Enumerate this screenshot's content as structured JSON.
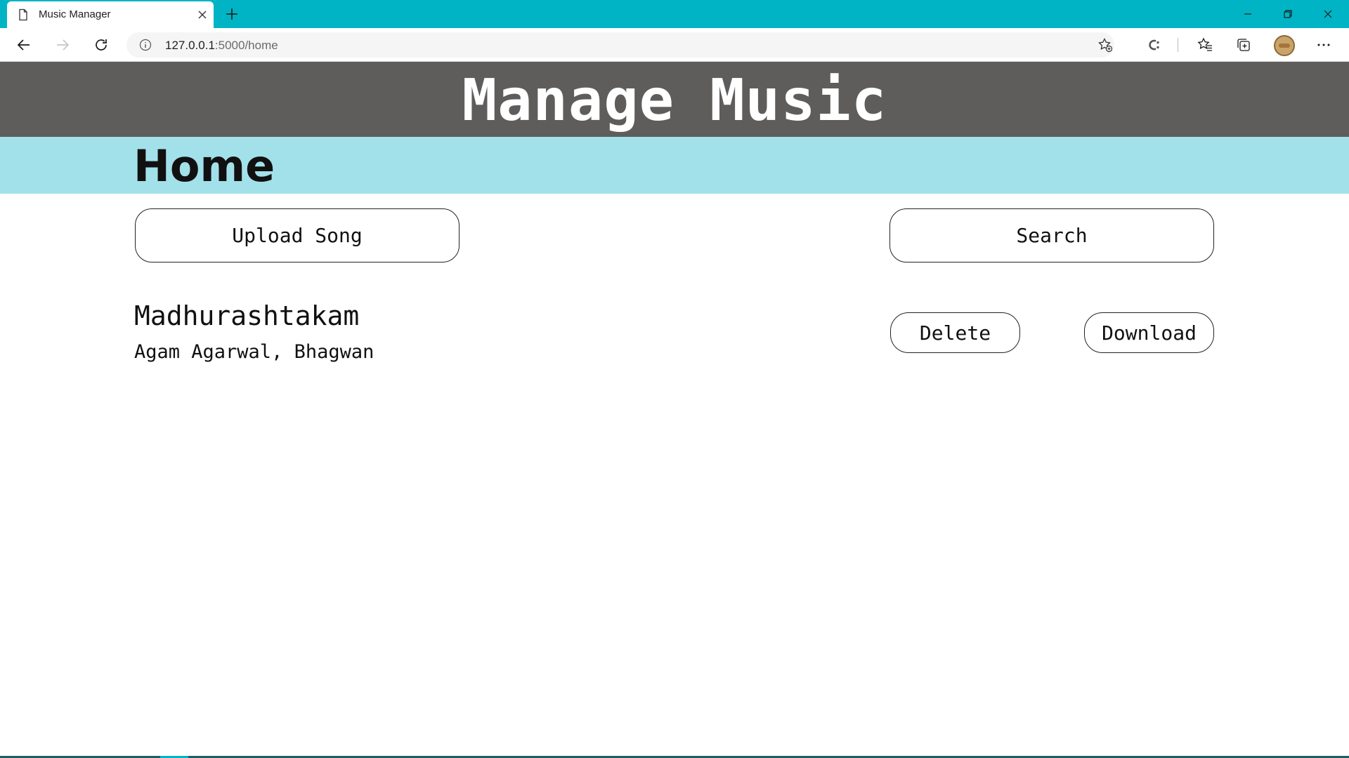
{
  "browser": {
    "tab_title": "Music Manager",
    "url_host": "127.0.0.1",
    "url_path": ":5000/home",
    "theme_color": "#00b4c5",
    "icons": [
      "page-icon",
      "close-icon",
      "plus-icon",
      "minimize-icon",
      "restore-icon",
      "window-close-icon",
      "back-arrow-icon",
      "forward-arrow-icon",
      "refresh-icon",
      "info-icon",
      "add-favorite-icon",
      "extension-icon",
      "favorites-icon",
      "collections-icon",
      "avatar",
      "more-icon"
    ]
  },
  "header": {
    "title": "Manage Music",
    "background": "#5e5d5c"
  },
  "subheader": {
    "heading": "Home",
    "background": "#a3e1ea"
  },
  "actions": {
    "upload_label": "Upload Song",
    "search_label": "Search"
  },
  "songs": [
    {
      "title": "Madhurashtakam",
      "artists": "Agam Agarwal, Bhagwan",
      "delete_label": "Delete",
      "download_label": "Download"
    }
  ]
}
